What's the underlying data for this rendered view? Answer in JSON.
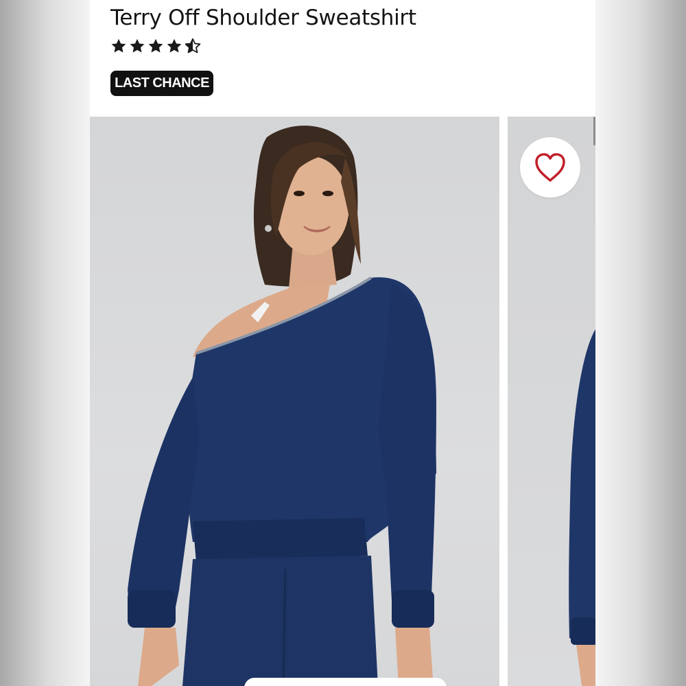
{
  "product": {
    "title": "Terry Off Shoulder Sweatshirt",
    "rating": 4.5,
    "rating_max": 5,
    "badge": "LAST CHANCE"
  },
  "icons": {
    "favorite": "heart-outline-icon",
    "rating": "star-icon"
  },
  "colors": {
    "badge_bg": "#111111",
    "heart": "#c0202a",
    "star": "#1a1a1a",
    "garment": "#1f3668"
  }
}
